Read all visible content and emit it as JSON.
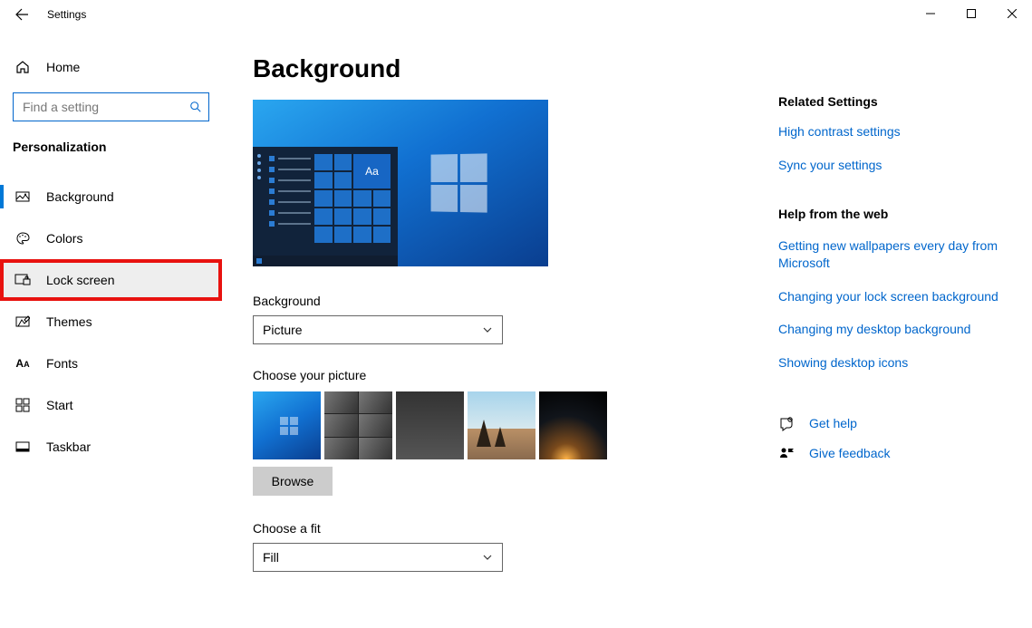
{
  "window": {
    "title": "Settings"
  },
  "sidebar": {
    "home": "Home",
    "search_placeholder": "Find a setting",
    "section": "Personalization",
    "items": [
      {
        "label": "Background"
      },
      {
        "label": "Colors"
      },
      {
        "label": "Lock screen"
      },
      {
        "label": "Themes"
      },
      {
        "label": "Fonts"
      },
      {
        "label": "Start"
      },
      {
        "label": "Taskbar"
      }
    ]
  },
  "main": {
    "heading": "Background",
    "preview_tile_text": "Aa",
    "background_label": "Background",
    "background_value": "Picture",
    "choose_picture_label": "Choose your picture",
    "browse_label": "Browse",
    "choose_fit_label": "Choose a fit",
    "fit_value": "Fill"
  },
  "aside": {
    "related_header": "Related Settings",
    "links": [
      "High contrast settings",
      "Sync your settings"
    ],
    "help_header": "Help from the web",
    "help_links": [
      "Getting new wallpapers every day from Microsoft",
      "Changing your lock screen background",
      "Changing my desktop background",
      "Showing desktop icons"
    ],
    "get_help": "Get help",
    "feedback": "Give feedback"
  }
}
